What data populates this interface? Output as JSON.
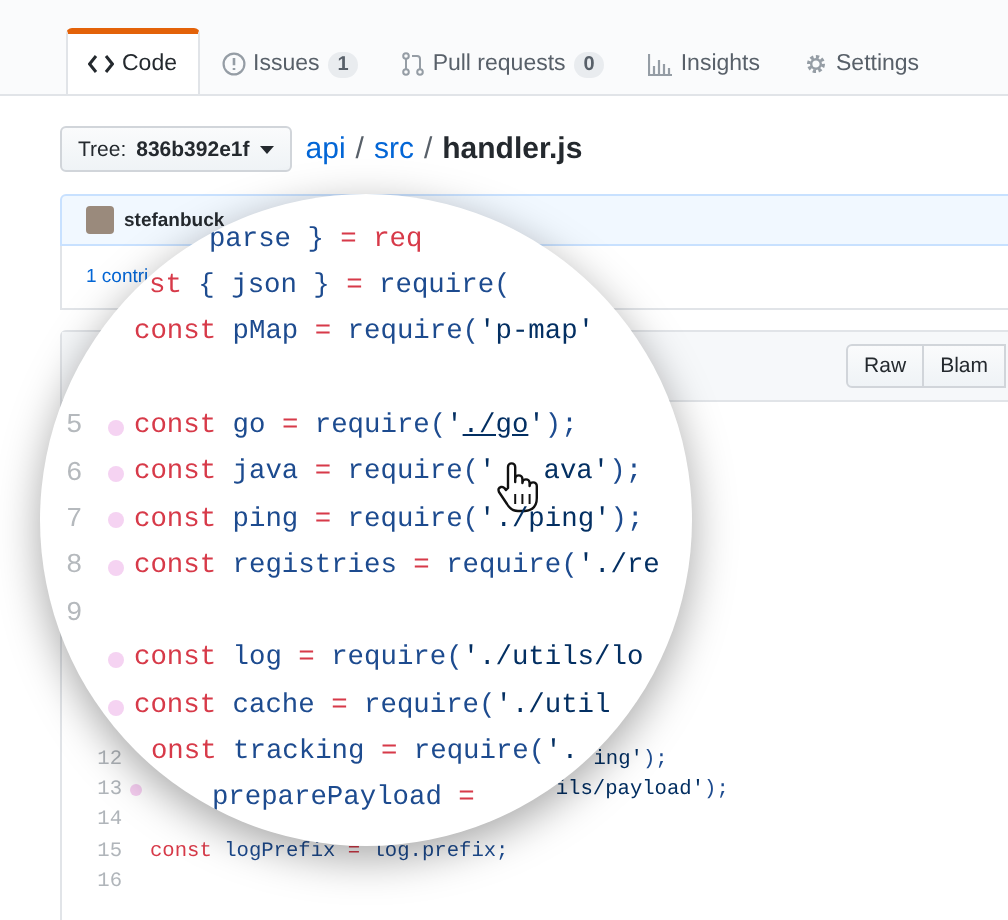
{
  "tabs": [
    {
      "kind": "code",
      "label": "Code",
      "selected": true
    },
    {
      "kind": "issues",
      "label": "Issues",
      "count": "1",
      "selected": false
    },
    {
      "kind": "pulls",
      "label": "Pull requests",
      "count": "0",
      "selected": false
    },
    {
      "kind": "insights",
      "label": "Insights",
      "selected": false
    },
    {
      "kind": "settings",
      "label": "Settings",
      "selected": false
    }
  ],
  "tree_button": {
    "label": "Tree: **836b392e1f**"
  },
  "breadcrumb": [
    {
      "kind": "link",
      "text": "api"
    },
    {
      "kind": "separator",
      "text": "/"
    },
    {
      "kind": "link",
      "text": "src"
    },
    {
      "kind": "separator",
      "text": "/"
    },
    {
      "kind": "current",
      "text": "handler.js"
    }
  ],
  "commit": {
    "author": "stefanbuck"
  },
  "contributors": {
    "text": "1 contri"
  },
  "file_actions": [
    {
      "label": "Raw"
    },
    {
      "label": "Blam"
    }
  ],
  "code_rows": [
    {
      "number": "12",
      "pieces": [
        {
          "kind": "text",
          "tokens": [
            {
              "kind": "string",
              "text": "ing'"
            },
            {
              "kind": "name",
              "text": ");"
            }
          ]
        }
      ]
    },
    {
      "number": "13",
      "marked": true,
      "pieces": [
        {
          "kind": "text",
          "tokens": [
            {
              "kind": "string",
              "text": "ils/payload'"
            },
            {
              "kind": "name",
              "text": ");"
            }
          ]
        }
      ]
    },
    {
      "number": "14"
    },
    {
      "number": "15",
      "pieces": [
        {
          "kind": "text",
          "tokens": [
            {
              "kind": "keyword",
              "text": "const"
            },
            {
              "kind": "name",
              "text": " logPrefix "
            },
            {
              "kind": "operator",
              "text": "="
            },
            {
              "kind": "name",
              "text": " log.prefix;"
            }
          ]
        }
      ]
    },
    {
      "number": "16"
    }
  ],
  "lens": {
    "rows": [
      {
        "pieces": [
          {
            "kind": "text",
            "tokens": [
              {
                "kind": "name",
                "text": "parse } "
              },
              {
                "kind": "operator",
                "text": "= req"
              }
            ]
          }
        ]
      },
      {
        "pieces": [
          {
            "kind": "text",
            "tokens": [
              {
                "kind": "keyword",
                "text": "st"
              },
              {
                "kind": "name",
                "text": " { json } "
              },
              {
                "kind": "operator",
                "text": "="
              },
              {
                "kind": "name",
                "text": " require("
              }
            ]
          }
        ]
      },
      {
        "pieces": [
          {
            "kind": "text",
            "tokens": [
              {
                "kind": "keyword",
                "text": "const"
              },
              {
                "kind": "name",
                "text": " pMap "
              },
              {
                "kind": "operator",
                "text": "="
              },
              {
                "kind": "name",
                "text": " require("
              },
              {
                "kind": "string",
                "text": "'p-map'"
              }
            ]
          }
        ]
      },
      {},
      {
        "number": "5",
        "marked": true,
        "pieces": [
          {
            "kind": "text",
            "tokens": [
              {
                "kind": "keyword",
                "text": "const"
              },
              {
                "kind": "name",
                "text": " go "
              },
              {
                "kind": "operator",
                "text": "="
              },
              {
                "kind": "name",
                "text": " require("
              },
              {
                "kind": "string",
                "text": "'"
              },
              {
                "kind": "link",
                "text": "./go"
              },
              {
                "kind": "string",
                "text": "'"
              },
              {
                "kind": "name",
                "text": ");"
              }
            ]
          }
        ]
      },
      {
        "number": "6",
        "marked": true,
        "pieces": [
          {
            "kind": "text",
            "tokens": [
              {
                "kind": "keyword",
                "text": "const"
              },
              {
                "kind": "name",
                "text": " java "
              },
              {
                "kind": "operator",
                "text": "="
              },
              {
                "kind": "name",
                "text": " require("
              },
              {
                "kind": "string",
                "text": "'"
              }
            ]
          },
          {
            "kind": "cursor"
          },
          {
            "kind": "text",
            "tokens": [
              {
                "kind": "string",
                "text": "ava'"
              },
              {
                "kind": "name",
                "text": ");"
              }
            ]
          }
        ]
      },
      {
        "number": "7",
        "marked": true,
        "pieces": [
          {
            "kind": "text",
            "tokens": [
              {
                "kind": "keyword",
                "text": "const"
              },
              {
                "kind": "name",
                "text": " ping "
              },
              {
                "kind": "operator",
                "text": "="
              },
              {
                "kind": "name",
                "text": " require("
              },
              {
                "kind": "string",
                "text": "'./ping'"
              },
              {
                "kind": "name",
                "text": ");"
              }
            ]
          }
        ]
      },
      {
        "number": "8",
        "marked": true,
        "pieces": [
          {
            "kind": "text",
            "tokens": [
              {
                "kind": "keyword",
                "text": "const"
              },
              {
                "kind": "name",
                "text": " registries "
              },
              {
                "kind": "operator",
                "text": "="
              },
              {
                "kind": "name",
                "text": " require("
              },
              {
                "kind": "string",
                "text": "'./re"
              }
            ]
          }
        ]
      },
      {
        "number": "9"
      },
      {
        "marked": true,
        "pieces": [
          {
            "kind": "text",
            "tokens": [
              {
                "kind": "keyword",
                "text": "const"
              },
              {
                "kind": "name",
                "text": " log "
              },
              {
                "kind": "operator",
                "text": "="
              },
              {
                "kind": "name",
                "text": " require("
              },
              {
                "kind": "string",
                "text": "'./utils/lo"
              }
            ]
          }
        ]
      },
      {
        "marked": true,
        "pieces": [
          {
            "kind": "text",
            "tokens": [
              {
                "kind": "keyword",
                "text": "const"
              },
              {
                "kind": "name",
                "text": " cache "
              },
              {
                "kind": "operator",
                "text": "="
              },
              {
                "kind": "name",
                "text": " require("
              },
              {
                "kind": "string",
                "text": "'./util"
              }
            ]
          }
        ]
      },
      {
        "pieces": [
          {
            "kind": "text",
            "tokens": [
              {
                "kind": "keyword",
                "text": "onst"
              },
              {
                "kind": "name",
                "text": " tracking "
              },
              {
                "kind": "operator",
                "text": "="
              },
              {
                "kind": "name",
                "text": " require("
              },
              {
                "kind": "string",
                "text": "'."
              }
            ]
          }
        ]
      },
      {
        "pieces": [
          {
            "kind": "text",
            "tokens": [
              {
                "kind": "name",
                "text": "preparePayload "
              },
              {
                "kind": "operator",
                "text": "="
              }
            ]
          }
        ]
      }
    ]
  }
}
